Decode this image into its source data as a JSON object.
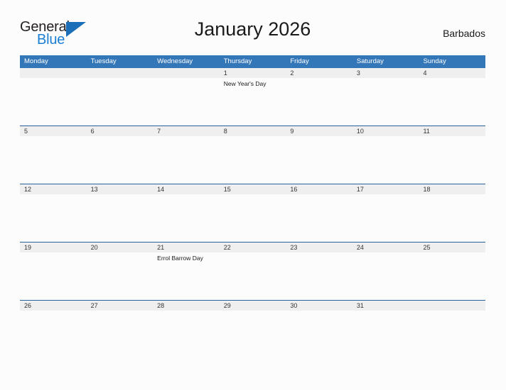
{
  "brand": {
    "name_part1": "General",
    "name_part2": "Blue",
    "flag_icon": "triangle-flag-icon",
    "accent_color": "#1a7fd4"
  },
  "header": {
    "title": "January 2026",
    "country": "Barbados"
  },
  "theme": {
    "header_bar_color": "#3477b8",
    "row_separator_color": "#2a6099",
    "daynum_strip_color": "#efefef",
    "page_background": "#fcfcfc"
  },
  "calendar": {
    "month": "January",
    "year": "2026",
    "weekday_headers": [
      "Monday",
      "Tuesday",
      "Wednesday",
      "Thursday",
      "Friday",
      "Saturday",
      "Sunday"
    ],
    "weeks": [
      {
        "days": [
          {
            "num": "",
            "events": []
          },
          {
            "num": "",
            "events": []
          },
          {
            "num": "",
            "events": []
          },
          {
            "num": "1",
            "events": [
              "New Year's Day"
            ]
          },
          {
            "num": "2",
            "events": []
          },
          {
            "num": "3",
            "events": []
          },
          {
            "num": "4",
            "events": []
          }
        ]
      },
      {
        "days": [
          {
            "num": "5",
            "events": []
          },
          {
            "num": "6",
            "events": []
          },
          {
            "num": "7",
            "events": []
          },
          {
            "num": "8",
            "events": []
          },
          {
            "num": "9",
            "events": []
          },
          {
            "num": "10",
            "events": []
          },
          {
            "num": "11",
            "events": []
          }
        ]
      },
      {
        "days": [
          {
            "num": "12",
            "events": []
          },
          {
            "num": "13",
            "events": []
          },
          {
            "num": "14",
            "events": []
          },
          {
            "num": "15",
            "events": []
          },
          {
            "num": "16",
            "events": []
          },
          {
            "num": "17",
            "events": []
          },
          {
            "num": "18",
            "events": []
          }
        ]
      },
      {
        "days": [
          {
            "num": "19",
            "events": []
          },
          {
            "num": "20",
            "events": []
          },
          {
            "num": "21",
            "events": [
              "Errol Barrow Day"
            ]
          },
          {
            "num": "22",
            "events": []
          },
          {
            "num": "23",
            "events": []
          },
          {
            "num": "24",
            "events": []
          },
          {
            "num": "25",
            "events": []
          }
        ]
      },
      {
        "days": [
          {
            "num": "26",
            "events": []
          },
          {
            "num": "27",
            "events": []
          },
          {
            "num": "28",
            "events": []
          },
          {
            "num": "29",
            "events": []
          },
          {
            "num": "30",
            "events": []
          },
          {
            "num": "31",
            "events": []
          },
          {
            "num": "",
            "events": []
          }
        ]
      }
    ]
  }
}
